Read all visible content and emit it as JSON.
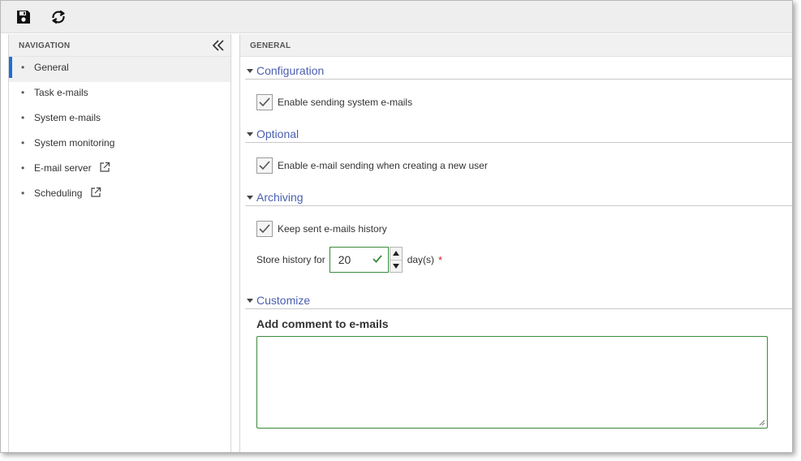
{
  "toolbar": {
    "save_icon": "floppy-disk-icon",
    "refresh_icon": "refresh-icon"
  },
  "navigation": {
    "title": "NAVIGATION",
    "collapse_icon": "double-chevron-left-icon",
    "items": [
      {
        "label": "General",
        "active": true,
        "external": false
      },
      {
        "label": "Task e-mails",
        "active": false,
        "external": false
      },
      {
        "label": "System e-mails",
        "active": false,
        "external": false
      },
      {
        "label": "System monitoring",
        "active": false,
        "external": false
      },
      {
        "label": "E-mail server",
        "active": false,
        "external": true
      },
      {
        "label": "Scheduling",
        "active": false,
        "external": true
      }
    ]
  },
  "general": {
    "title": "GENERAL",
    "sections": {
      "configuration": {
        "title": "Configuration",
        "option_label": "Enable sending system e-mails",
        "checked": true
      },
      "optional": {
        "title": "Optional",
        "option_label": "Enable e-mail sending when creating a new user",
        "checked": true
      },
      "archiving": {
        "title": "Archiving",
        "option_label": "Keep sent e-mails history",
        "checked": true,
        "store_label": "Store history for",
        "store_value": "20",
        "unit": "day(s)",
        "required_mark": "*"
      },
      "customize": {
        "title": "Customize",
        "comment_label": "Add comment to e-mails",
        "comment_value": ""
      }
    }
  },
  "colors": {
    "accent": "#1e6fd9",
    "section_title": "#4a5fb0",
    "valid_border": "#3a8a3a",
    "required": "#d02020"
  }
}
